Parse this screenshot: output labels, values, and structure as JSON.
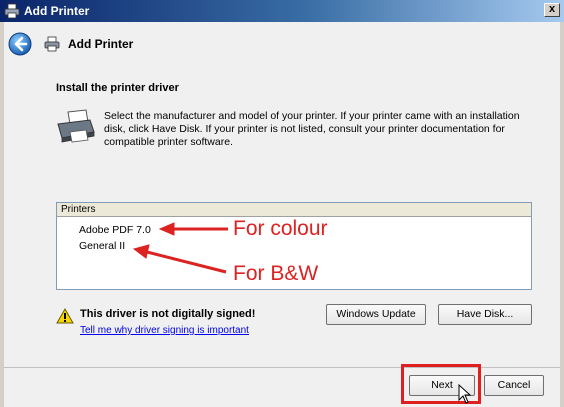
{
  "window": {
    "title": "Add Printer",
    "close_glyph": "x"
  },
  "header": {
    "title": "Add Printer"
  },
  "section": {
    "title": "Install the printer driver",
    "instructions": "Select the manufacturer and model of your printer. If your printer came with an installation disk, click Have Disk. If your printer is not listed, consult your printer documentation for compatible printer software."
  },
  "printers": {
    "header": "Printers",
    "items": [
      "Adobe PDF 7.0",
      "General II"
    ]
  },
  "annotations": {
    "colour": "For colour",
    "bw": "For B&W"
  },
  "warning": {
    "text": "This driver is not digitally signed!",
    "link": "Tell me why driver signing is important"
  },
  "buttons": {
    "windows_update": "Windows Update",
    "have_disk": "Have Disk...",
    "next": "Next",
    "cancel": "Cancel"
  },
  "icons": {
    "title": "printer-icon",
    "back": "back-arrow-icon",
    "header": "printer-icon",
    "large": "printer-icon",
    "warning": "warning-icon",
    "cursor": "mouse-cursor-icon"
  },
  "colors": {
    "annotation": "#dd2222",
    "highlight": "#e02020",
    "link": "#0000ee",
    "titlebar": "#0a246a"
  }
}
